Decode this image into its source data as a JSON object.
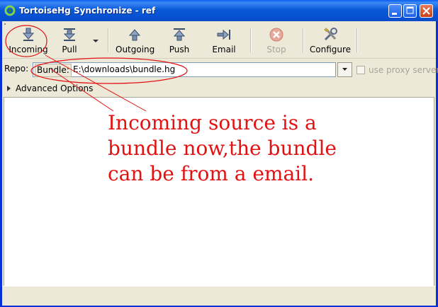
{
  "window": {
    "title": "TortoiseHg Synchronize - ref"
  },
  "toolbar": {
    "incoming": "Incoming",
    "pull": "Pull",
    "outgoing": "Outgoing",
    "push": "Push",
    "email": "Email",
    "stop": "Stop",
    "configure": "Configure"
  },
  "repo": {
    "label": "Repo:",
    "prefix": "Bundle:",
    "value": "E:\\downloads\\bundle.hg",
    "use_proxy": "use proxy server"
  },
  "advanced": {
    "label": "Advanced Options"
  },
  "annotation": {
    "text": "Incoming source is a\nbundle now,the bundle\ncan be from a email."
  },
  "colors": {
    "annotation": "#e21212",
    "titlebar": "#0a5ad8"
  }
}
